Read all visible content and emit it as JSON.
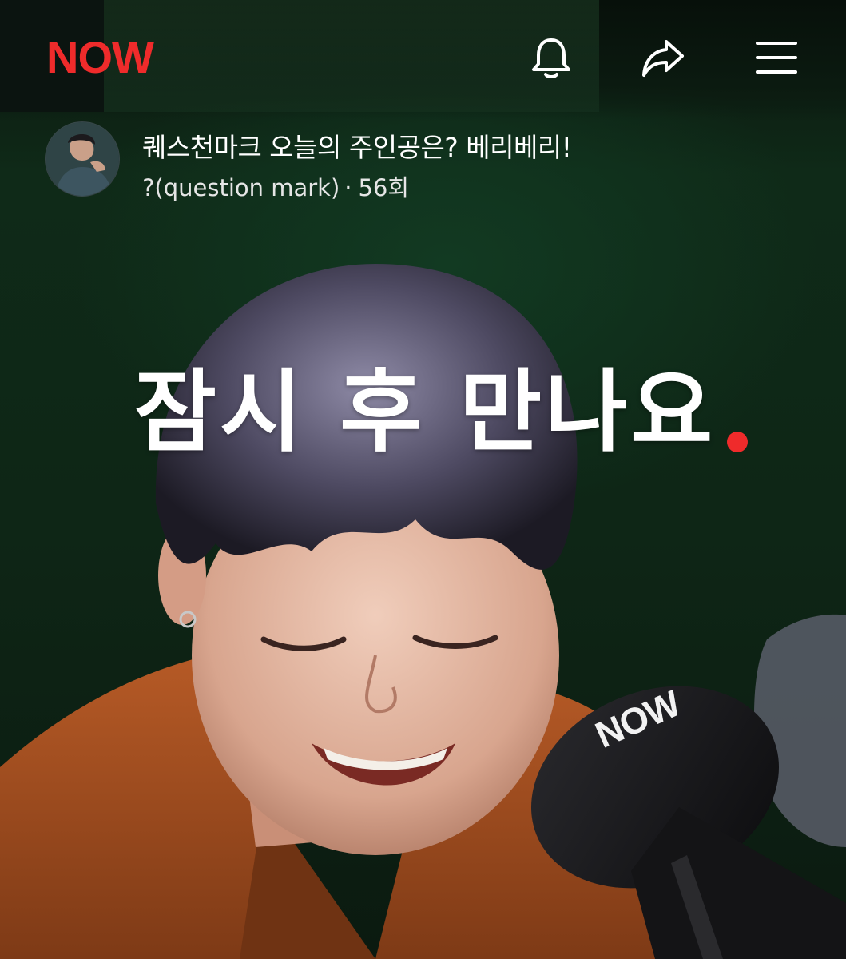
{
  "app": {
    "logo": "NOW",
    "accent": "#ef2b2b"
  },
  "header": {
    "icons": [
      "bell-icon",
      "share-icon",
      "menu-icon"
    ]
  },
  "channel": {
    "title": "퀘스천마크 오늘의 주인공은? 베리베리!",
    "host": "?(question mark)",
    "separator": "·",
    "episode": "56회"
  },
  "video": {
    "overlay_text": "잠시 후 만나요",
    "mic_brand": "NOW"
  }
}
